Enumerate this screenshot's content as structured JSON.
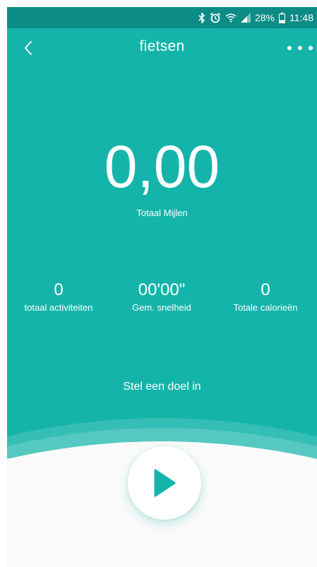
{
  "colors": {
    "primary": "#14b4aa",
    "statusbar": "#0b8c86",
    "background": "#fafafa",
    "accent": "#14b4aa"
  },
  "statusbar": {
    "icons": [
      "bluetooth-icon",
      "alarm-icon",
      "wifi-icon",
      "signal-icon",
      "battery-icon"
    ],
    "battery": "28%",
    "time": "11:48"
  },
  "header": {
    "back_icon": "chevron-left-icon",
    "title": "fietsen",
    "more_icon": "more-dots-icon"
  },
  "summary": {
    "total_value": "0,00",
    "total_label": "Totaal Mijlen"
  },
  "stats": [
    {
      "value": "0",
      "label": "totaal activiteiten"
    },
    {
      "value": "00'00\"",
      "label": "Gem. snelheid"
    },
    {
      "value": "0",
      "label": "Totale calorieën"
    }
  ],
  "goal": {
    "label": "Stel een doel in"
  },
  "actions": {
    "play_icon": "play-icon"
  }
}
